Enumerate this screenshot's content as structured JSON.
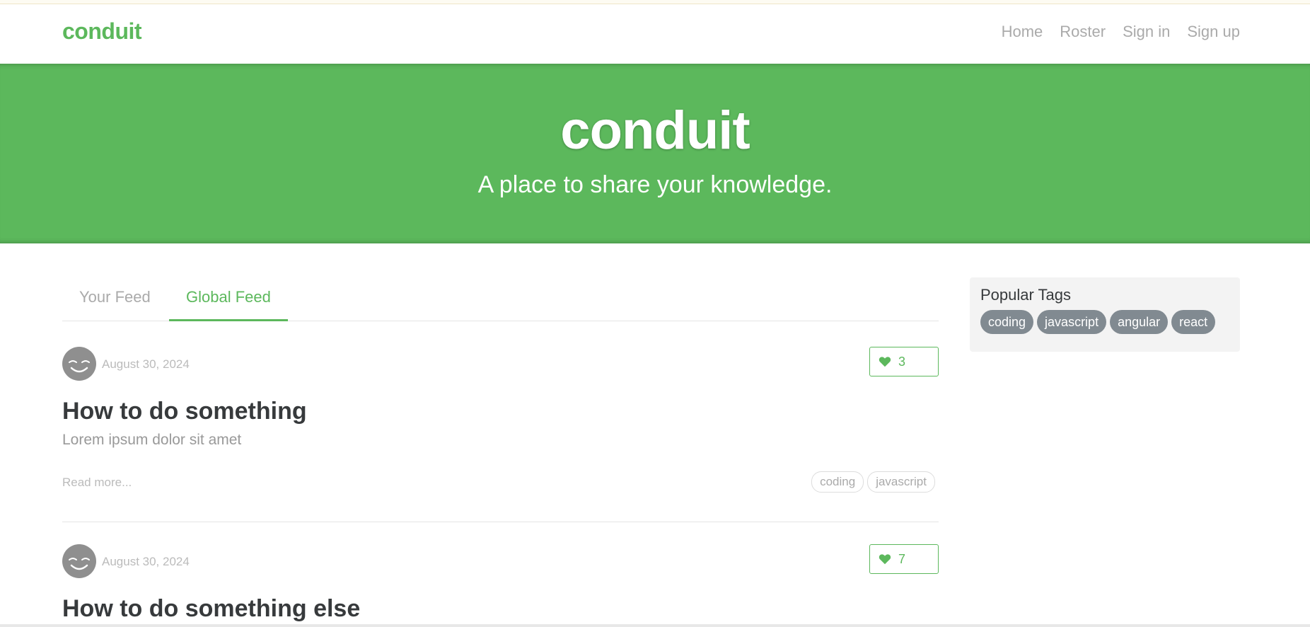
{
  "navbar": {
    "brand": "conduit",
    "links": [
      "Home",
      "Roster",
      "Sign in",
      "Sign up"
    ]
  },
  "banner": {
    "title": "conduit",
    "subtitle": "A place to share your knowledge."
  },
  "feed": {
    "tabs": [
      "Your Feed",
      "Global Feed"
    ],
    "active_tab": "Global Feed"
  },
  "articles": [
    {
      "date": "August 30, 2024",
      "favorites": "3",
      "title": "How to do something",
      "description": "Lorem ipsum dolor sit amet",
      "read_more": "Read more...",
      "tags": [
        "coding",
        "javascript"
      ]
    },
    {
      "date": "August 30, 2024",
      "favorites": "7",
      "title": "How to do something else"
    }
  ],
  "sidebar": {
    "title": "Popular Tags",
    "tags": [
      "coding",
      "javascript",
      "angular",
      "react"
    ]
  },
  "colors": {
    "brand": "#5cb85c",
    "tag_pill": "#818a91"
  },
  "icons": {
    "favorite": "heart-icon",
    "avatar": "smiley-avatar"
  }
}
